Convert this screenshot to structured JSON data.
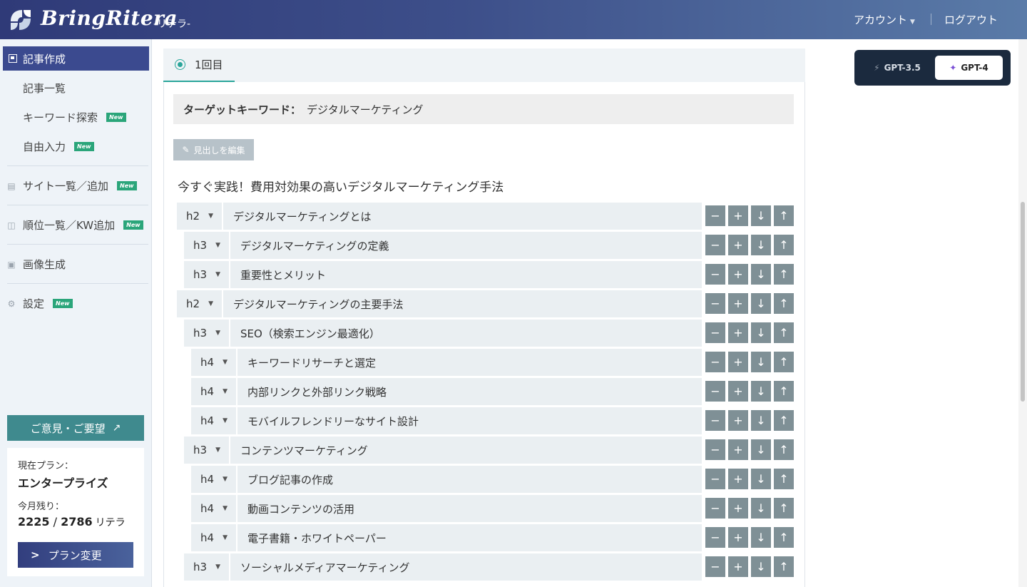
{
  "header": {
    "brand": "BringRitera",
    "brand_sub": "-リテラ-",
    "account": "アカウント",
    "logout": "ログアウト"
  },
  "sidebar": {
    "active_item": "記事作成",
    "sub_items": [
      {
        "label": "記事一覧",
        "badge": ""
      },
      {
        "label": "キーワード探索",
        "badge": "New"
      },
      {
        "label": "自由入力",
        "badge": "New"
      }
    ],
    "main_items": [
      {
        "label": "サイト一覧／追加",
        "badge": "New",
        "icon": "document-icon"
      },
      {
        "label": "順位一覧／KW追加",
        "badge": "New",
        "icon": "chart-icon"
      },
      {
        "label": "画像生成",
        "badge": "",
        "icon": "image-icon"
      },
      {
        "label": "設定",
        "badge": "New",
        "icon": "gear-icon"
      }
    ],
    "feedback": "ご意見・ご要望",
    "plan": {
      "current_label": "現在プラン：",
      "current_value": "エンタープライズ",
      "remaining_label": "今月残り：",
      "remaining": "2225",
      "separator": "/",
      "total": "2786",
      "unit": "リテラ",
      "change_button": "プラン変更"
    }
  },
  "main": {
    "tab": "1回目",
    "keyword_label": "ターゲットキーワード：",
    "keyword_value": "デジタルマーケティング",
    "edit_button": "見出しを編集",
    "article_title": "今すぐ実践！費用対効果の高いデジタルマーケティング手法",
    "headings": [
      {
        "level": "h2",
        "text": "デジタルマーケティングとは"
      },
      {
        "level": "h3",
        "text": "デジタルマーケティングの定義"
      },
      {
        "level": "h3",
        "text": "重要性とメリット"
      },
      {
        "level": "h2",
        "text": "デジタルマーケティングの主要手法"
      },
      {
        "level": "h3",
        "text": "SEO（検索エンジン最適化）"
      },
      {
        "level": "h4",
        "text": "キーワードリサーチと選定"
      },
      {
        "level": "h4",
        "text": "内部リンクと外部リンク戦略"
      },
      {
        "level": "h4",
        "text": "モバイルフレンドリーなサイト設計"
      },
      {
        "level": "h3",
        "text": "コンテンツマーケティング"
      },
      {
        "level": "h4",
        "text": "ブログ記事の作成"
      },
      {
        "level": "h4",
        "text": "動画コンテンツの活用"
      },
      {
        "level": "h4",
        "text": "電子書籍・ホワイトペーパー"
      },
      {
        "level": "h3",
        "text": "ソーシャルメディアマーケティング"
      }
    ],
    "row_buttons": {
      "remove": "−",
      "add": "+",
      "down": "↓",
      "up": "↑"
    }
  },
  "model_switch": {
    "gpt35": "GPT-3.5",
    "gpt4": "GPT-4",
    "selected": "GPT-4"
  },
  "colors": {
    "header_start": "#2f3a78",
    "header_end": "#5a7ba8",
    "sidebar_active": "#3b4a8f",
    "accent_teal": "#2aa59a",
    "new_badge": "#2aa57a",
    "row_button": "#7f9096"
  }
}
